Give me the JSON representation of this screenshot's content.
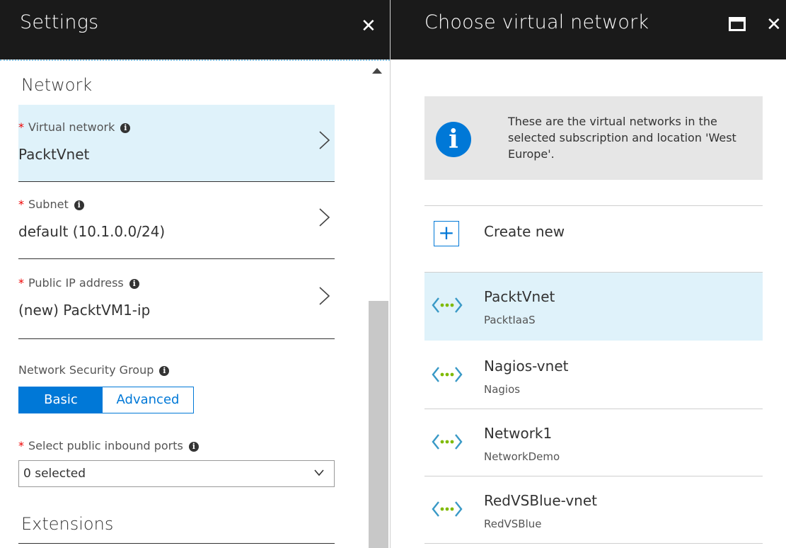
{
  "settings": {
    "title": "Settings",
    "close_label": "✕",
    "network_section": "Network",
    "virtual_network": {
      "label": "Virtual network",
      "value": "PacktVnet"
    },
    "subnet": {
      "label": "Subnet",
      "value": "default (10.1.0.0/24)"
    },
    "public_ip": {
      "label": "Public IP address",
      "value": "(new) PacktVM1-ip"
    },
    "nsg": {
      "label": "Network Security Group",
      "options": [
        "Basic",
        "Advanced"
      ],
      "selected": "Basic"
    },
    "inbound_ports": {
      "label": "Select public inbound ports",
      "value": "0 selected"
    },
    "extensions_section": "Extensions"
  },
  "chooser": {
    "title": "Choose virtual network",
    "info_text": "These are the virtual networks in the selected subscription and location 'West Europe'.",
    "create_new": "Create new",
    "networks": [
      {
        "name": "PacktVnet",
        "group": "PacktIaaS",
        "selected": true
      },
      {
        "name": "Nagios-vnet",
        "group": "Nagios",
        "selected": false
      },
      {
        "name": "Network1",
        "group": "NetworkDemo",
        "selected": false
      },
      {
        "name": "RedVSBlue-vnet",
        "group": "RedVSBlue",
        "selected": false
      }
    ]
  },
  "icons": {
    "close": "close-icon",
    "maximize": "maximize-icon",
    "info": "info-icon",
    "chevron": "chevron-right-icon",
    "dropdown": "chevron-down-icon",
    "vnet": "virtual-network-icon",
    "plus": "plus-icon"
  },
  "colors": {
    "header_bg": "#1a1a1a",
    "accent": "#0078d7",
    "selected_bg": "#dff2fa",
    "required": "#e00000",
    "vnet_icon_green": "#7fba00",
    "vnet_icon_blue": "#3999c6"
  }
}
